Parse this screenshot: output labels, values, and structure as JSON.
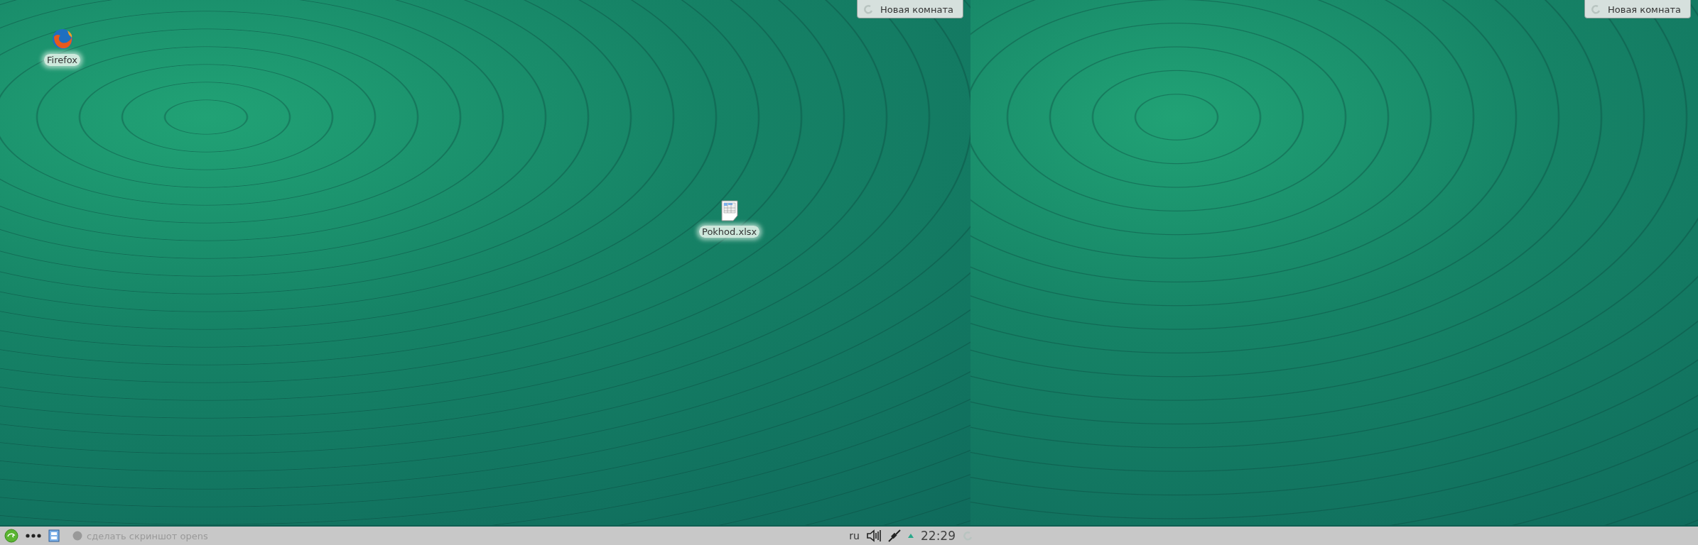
{
  "screens": [
    {
      "desktop_icons": [
        {
          "label": "Firefox",
          "kind": "browser"
        },
        {
          "label": "Pokhod.xlsx",
          "kind": "spreadsheet"
        }
      ],
      "notification": {
        "title": "Новая комната"
      }
    },
    {
      "notification": {
        "title": "Новая комната"
      }
    }
  ],
  "taskbar": {
    "tasks": [
      {
        "label": "сделать скриншот opens"
      }
    ],
    "keyboard_layout": "ru",
    "clock": "22:29"
  }
}
